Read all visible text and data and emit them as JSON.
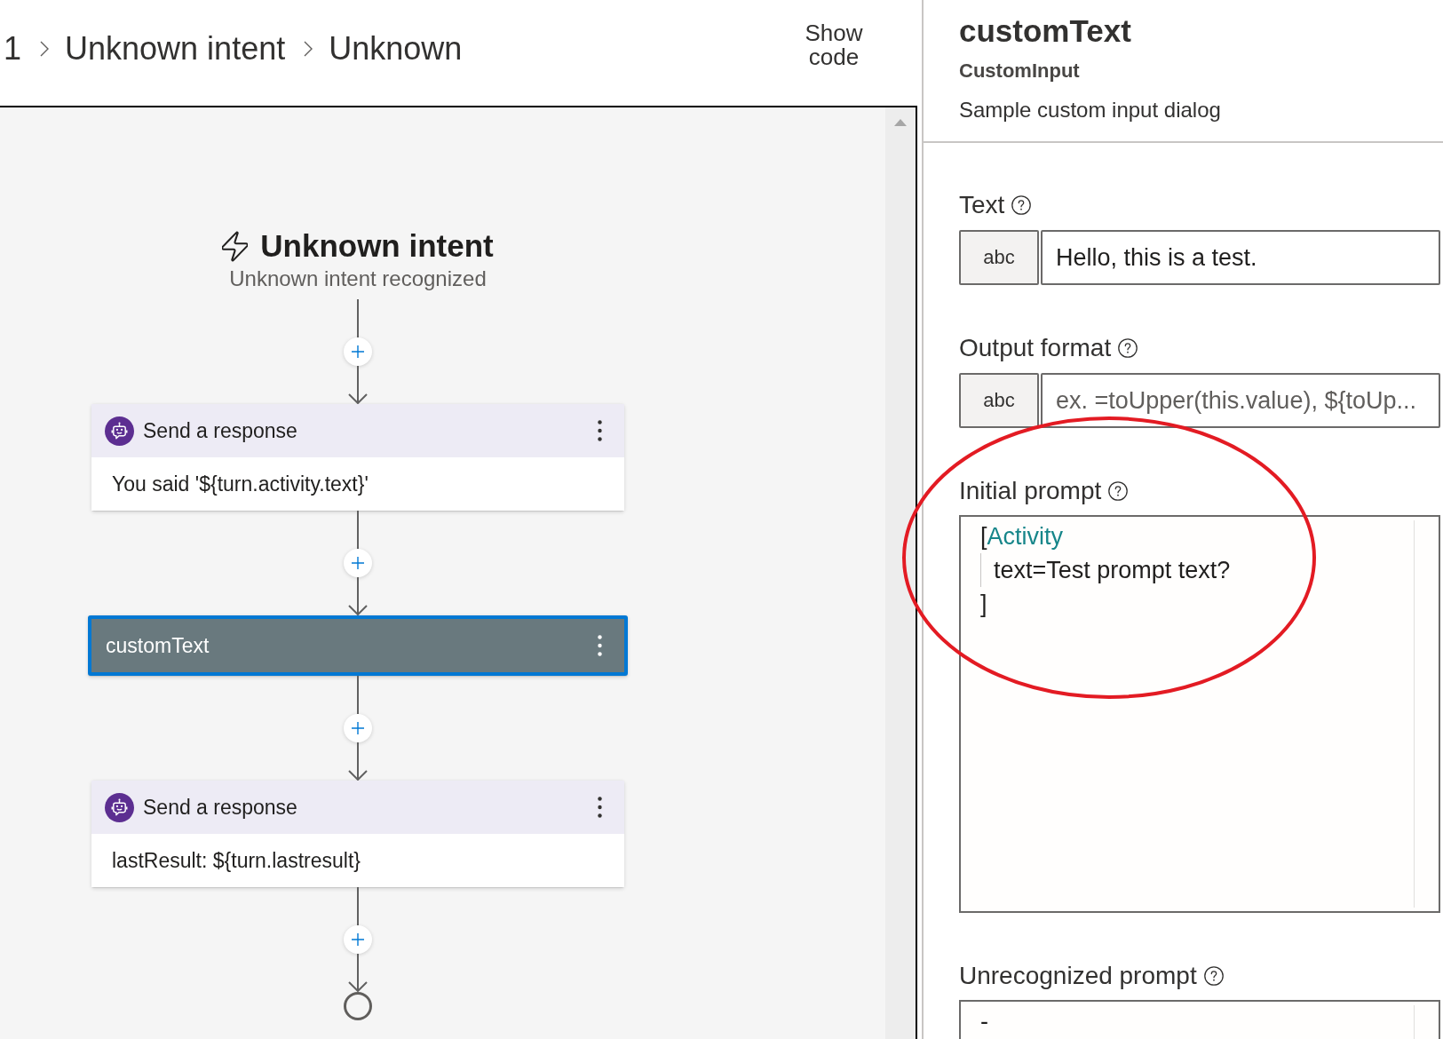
{
  "breadcrumb": [
    {
      "label": "1"
    },
    {
      "label": "Unknown intent"
    },
    {
      "label": "Unknown"
    }
  ],
  "show_code_button": {
    "label": "Show code"
  },
  "flow": {
    "trigger": {
      "title": "Unknown intent",
      "subtitle": "Unknown intent recognized"
    },
    "nodes": [
      {
        "kind": "response",
        "title": "Send a response",
        "body": "You said '${turn.activity.text}'",
        "selected": false
      },
      {
        "kind": "action",
        "title": "customText",
        "selected": true
      },
      {
        "kind": "response",
        "title": "Send a response",
        "body": "lastResult: ${turn.lastresult}",
        "selected": false
      }
    ]
  },
  "panel": {
    "title": "customText",
    "type": "CustomInput",
    "description": "Sample custom input dialog",
    "fields": [
      {
        "kind": "text",
        "label": "Text",
        "type_button": "abc",
        "value": "Hello, this is a test."
      },
      {
        "kind": "text",
        "label": "Output format",
        "type_button": "abc",
        "placeholder": "ex. =toUpper(this.value), ${toUp..."
      },
      {
        "kind": "code",
        "label": "Initial prompt",
        "lines": [
          {
            "tokens": [
              {
                "kind": "plain",
                "text": "["
              },
              {
                "kind": "type",
                "text": "Activity"
              }
            ],
            "children": [
              {
                "tokens": [
                  {
                    "kind": "plain",
                    "text": "text=Test prompt text?"
                  }
                ]
              }
            ]
          },
          {
            "tokens": [
              {
                "kind": "plain",
                "text": "]"
              }
            ]
          }
        ]
      },
      {
        "kind": "code",
        "label": "Unrecognized prompt",
        "lines": [
          {
            "tokens": [
              {
                "kind": "plain",
                "text": "-"
              }
            ]
          }
        ]
      }
    ]
  }
}
